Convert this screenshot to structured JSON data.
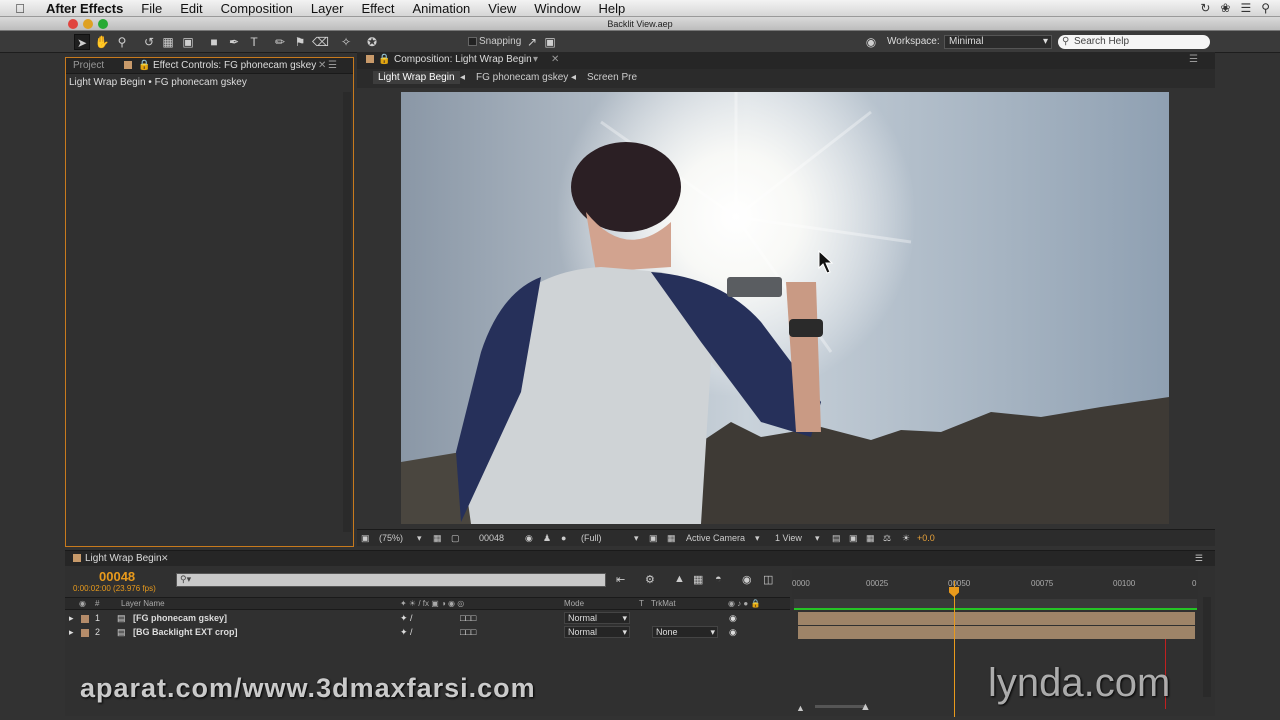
{
  "menubar": {
    "app_name": "After Effects",
    "items": [
      "File",
      "Edit",
      "Composition",
      "Layer",
      "Effect",
      "Animation",
      "View",
      "Window",
      "Help"
    ]
  },
  "window_title": "Backlit View.aep",
  "toolbar": {
    "snapping_label": "Snapping",
    "workspace_label": "Workspace:",
    "workspace_value": "Minimal",
    "search_placeholder": "Search Help"
  },
  "left_panel": {
    "tab_project": "Project",
    "tab_effect_controls": "Effect Controls: FG phonecam gskey",
    "subtitle": "Light Wrap Begin • FG phonecam gskey"
  },
  "comp_panel": {
    "tab_label": "Composition: Light Wrap Begin",
    "nav": [
      "Light Wrap Begin",
      "FG phonecam gskey",
      "Screen Pre"
    ],
    "footer": {
      "zoom": "(75%)",
      "frame": "00048",
      "resolution": "(Full)",
      "camera": "Active Camera",
      "views": "1 View",
      "exposure": "+0.0"
    }
  },
  "timeline": {
    "tab_label": "Light Wrap Begin",
    "timecode": "00048",
    "timecode_sub": "0:00:02:00 (23.976 fps)",
    "header": {
      "layer_name": "Layer Name",
      "mode": "Mode",
      "t": "T",
      "trkmat": "TrkMat",
      "num": "#"
    },
    "ruler_labels": [
      "0000",
      "00025",
      "00050",
      "00075",
      "00100",
      "0"
    ],
    "layers": [
      {
        "num": "1",
        "name": "[FG phonecam gskey]",
        "mode": "Normal",
        "trkmat": ""
      },
      {
        "num": "2",
        "name": "[BG Backlight EXT crop]",
        "mode": "Normal",
        "trkmat": "None"
      }
    ]
  },
  "watermarks": {
    "left": "aparat.com/www.3dmaxfarsi.com",
    "right": "lynda.com"
  }
}
